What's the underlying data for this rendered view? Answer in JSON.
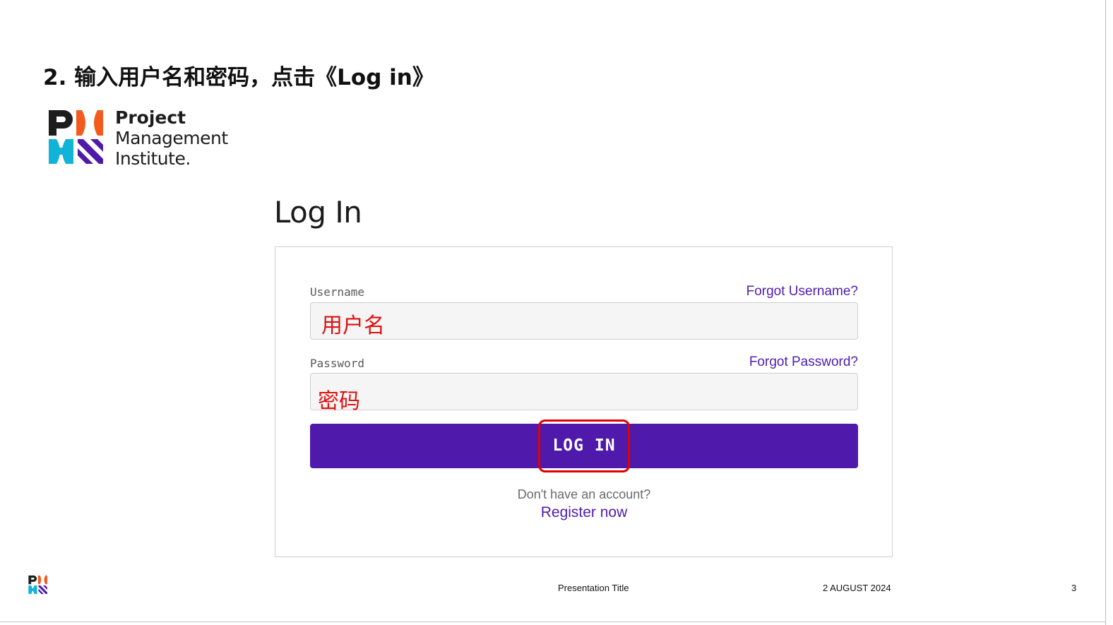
{
  "slide": {
    "title": "2.  输入用户名和密码，点击《Log in》"
  },
  "logo": {
    "line1": "Project",
    "line2": "Management",
    "line3": "Institute.",
    "colors": {
      "dark": "#1d1d1d",
      "orange": "#f25a1e",
      "cyan": "#11b3d6",
      "purple": "#4f19ab"
    }
  },
  "login": {
    "heading": "Log In",
    "username": {
      "label": "Username",
      "forgot_link": "Forgot Username?",
      "value": "用户名"
    },
    "password": {
      "label": "Password",
      "forgot_link": "Forgot Password?",
      "value": "密码"
    },
    "submit_label": "LOG IN",
    "no_account_text": "Don't have an account?",
    "register_link": "Register now",
    "accent_color": "#4f19ab",
    "annotation_color": "#e00000"
  },
  "footer": {
    "presentation_title": "Presentation Title",
    "date": "2 AUGUST 2024",
    "page_number": "3"
  }
}
